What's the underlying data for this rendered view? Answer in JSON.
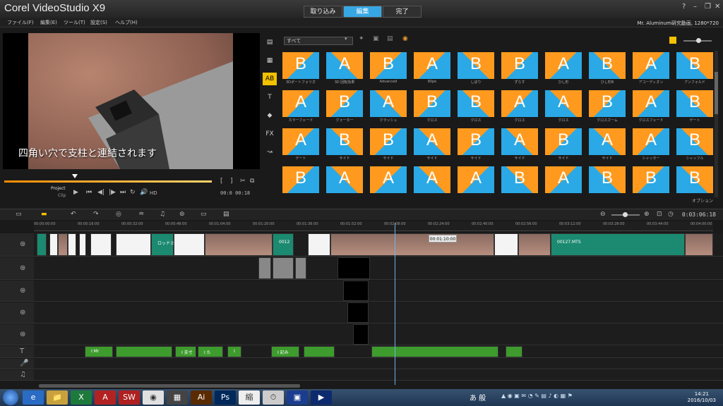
{
  "app": {
    "title": "Corel VideoStudio X9",
    "steps": [
      {
        "label": "取り込み",
        "active": false
      },
      {
        "label": "編集",
        "active": true
      },
      {
        "label": "完了",
        "active": false
      }
    ],
    "window_buttons": [
      "?",
      "–",
      "❐",
      "✕"
    ]
  },
  "menu": {
    "items": [
      "ファイル(F)",
      "編集(E)",
      "ツール(T)",
      "設定(S)",
      "ヘルプ(H)"
    ],
    "project_info": "Mr. Aluminum研究動画, 1280*720"
  },
  "preview": {
    "subtitle": "四角い穴で支柱と連結されます",
    "project_label": "Project",
    "clip_label": "Clip",
    "hd_label": "HD",
    "timecode": "00:0 00:18",
    "playhead_fraction": 0.34
  },
  "library": {
    "category_select": "すべて",
    "categories": [
      {
        "icon": "media-icon",
        "glyph": "▤"
      },
      {
        "icon": "instant-project-icon",
        "glyph": "▦"
      },
      {
        "icon": "transition-icon",
        "glyph": "AB"
      },
      {
        "icon": "title-icon",
        "glyph": "T"
      },
      {
        "icon": "graphics-icon",
        "glyph": "◆"
      },
      {
        "icon": "filter-icon",
        "glyph": "FX"
      },
      {
        "icon": "path-icon",
        "glyph": "↝"
      }
    ],
    "thumbnails": [
      {
        "label": "3Dポートフォリオ",
        "glyph": "B",
        "style": "o"
      },
      {
        "label": "3D 回転効果",
        "glyph": "A",
        "style": "b"
      },
      {
        "label": "Advanced",
        "glyph": "B",
        "style": "o"
      },
      {
        "label": "Wipe",
        "glyph": "A",
        "style": "o"
      },
      {
        "label": "しぼり",
        "glyph": "B",
        "style": "b"
      },
      {
        "label": "ずらす",
        "glyph": "B",
        "style": "o"
      },
      {
        "label": "ひし形",
        "glyph": "A",
        "style": "o"
      },
      {
        "label": "ひし形B",
        "glyph": "B",
        "style": "b"
      },
      {
        "label": "アコーディオン",
        "glyph": "A",
        "style": "o"
      },
      {
        "label": "アンフォルド",
        "glyph": "B",
        "style": "b"
      },
      {
        "label": "カラーフェード",
        "glyph": "A",
        "style": "o"
      },
      {
        "label": "クォーター",
        "glyph": "B",
        "style": "o"
      },
      {
        "label": "クラッシュ",
        "glyph": "A",
        "style": "b"
      },
      {
        "label": "クロス",
        "glyph": "B",
        "style": "o"
      },
      {
        "label": "クロス",
        "glyph": "B",
        "style": "b"
      },
      {
        "label": "クロス",
        "glyph": "A",
        "style": "o"
      },
      {
        "label": "クロス",
        "glyph": "A",
        "style": "b"
      },
      {
        "label": "クロスズーム",
        "glyph": "B",
        "style": "o"
      },
      {
        "label": "クロスフェード",
        "glyph": "A",
        "style": "o"
      },
      {
        "label": "ゲート",
        "glyph": "B",
        "style": "b"
      },
      {
        "label": "ゲート",
        "glyph": "A",
        "style": "o"
      },
      {
        "label": "サイド",
        "glyph": "B",
        "style": "b"
      },
      {
        "label": "サイド",
        "glyph": "B",
        "style": "o"
      },
      {
        "label": "サイド",
        "glyph": "A",
        "style": "b"
      },
      {
        "label": "サイド",
        "glyph": "B",
        "style": "o"
      },
      {
        "label": "サイド",
        "glyph": "A",
        "style": "b"
      },
      {
        "label": "サイド",
        "glyph": "B",
        "style": "o"
      },
      {
        "label": "サイド",
        "glyph": "A",
        "style": "b"
      },
      {
        "label": "シャッター",
        "glyph": "A",
        "style": "o"
      },
      {
        "label": "シャッフル",
        "glyph": "B",
        "style": "b"
      },
      {
        "label": "",
        "glyph": "B",
        "style": "o"
      },
      {
        "label": "",
        "glyph": "A",
        "style": "b"
      },
      {
        "label": "",
        "glyph": "A",
        "style": "o"
      },
      {
        "label": "",
        "glyph": "A",
        "style": "b"
      },
      {
        "label": "",
        "glyph": "A",
        "style": "o"
      },
      {
        "label": "",
        "glyph": "B",
        "style": "b"
      },
      {
        "label": "",
        "glyph": "A",
        "style": "o"
      },
      {
        "label": "",
        "glyph": "B",
        "style": "b"
      },
      {
        "label": "",
        "glyph": "B",
        "style": "o"
      },
      {
        "label": "",
        "glyph": "B",
        "style": "b"
      }
    ],
    "options_label": "オプション"
  },
  "timeline": {
    "toolbar_buttons": [
      "storyboard-view-icon",
      "timeline-view-icon",
      "undo-icon",
      "redo-icon",
      "record-icon",
      "audio-mixer-icon",
      "auto-music-icon",
      "motion-tracking-icon",
      "subtitle-editor-icon",
      "multi-trim-icon"
    ],
    "timecode": "0:03:06:18",
    "ruler_labels": [
      "00:00:00:00",
      "00:00:16:00",
      "00:00:32:00",
      "00:00:48:00",
      "00:01:04:00",
      "00:01:20:00",
      "00:01:36:00",
      "00:01:52:00",
      "00:02:08:00",
      "00:02:24:00",
      "00:02:40:00",
      "00:02:56:00",
      "00:03:12:00",
      "00:03:28:00",
      "00:03:44:00",
      "00:04:00:00"
    ],
    "playhead_time": "00:01:10:00",
    "clip_labels": [
      "ロッドミ",
      "0012",
      "00127.MTS"
    ],
    "title_clip_labels": [
      "I Mr",
      "I 支寸",
      "I た",
      "I",
      "I 記み"
    ]
  },
  "taskbar": {
    "apps": [
      "ie-icon",
      "explorer-icon",
      "excel-icon",
      "acrobat-icon",
      "solidworks-icon",
      "chrome-icon",
      "apps-icon",
      "illustrator-icon",
      "photoshop-icon",
      "japanese-icon",
      "clock-app-icon",
      "monitor-icon",
      "videostudio-icon"
    ],
    "app_glyphs": [
      "e",
      "📁",
      "X",
      "A",
      "SW",
      "◉",
      "▦",
      "Ai",
      "Ps",
      "縮",
      "⏱",
      "▣",
      "▶"
    ],
    "time": "14:21",
    "date": "2016/10/03"
  }
}
